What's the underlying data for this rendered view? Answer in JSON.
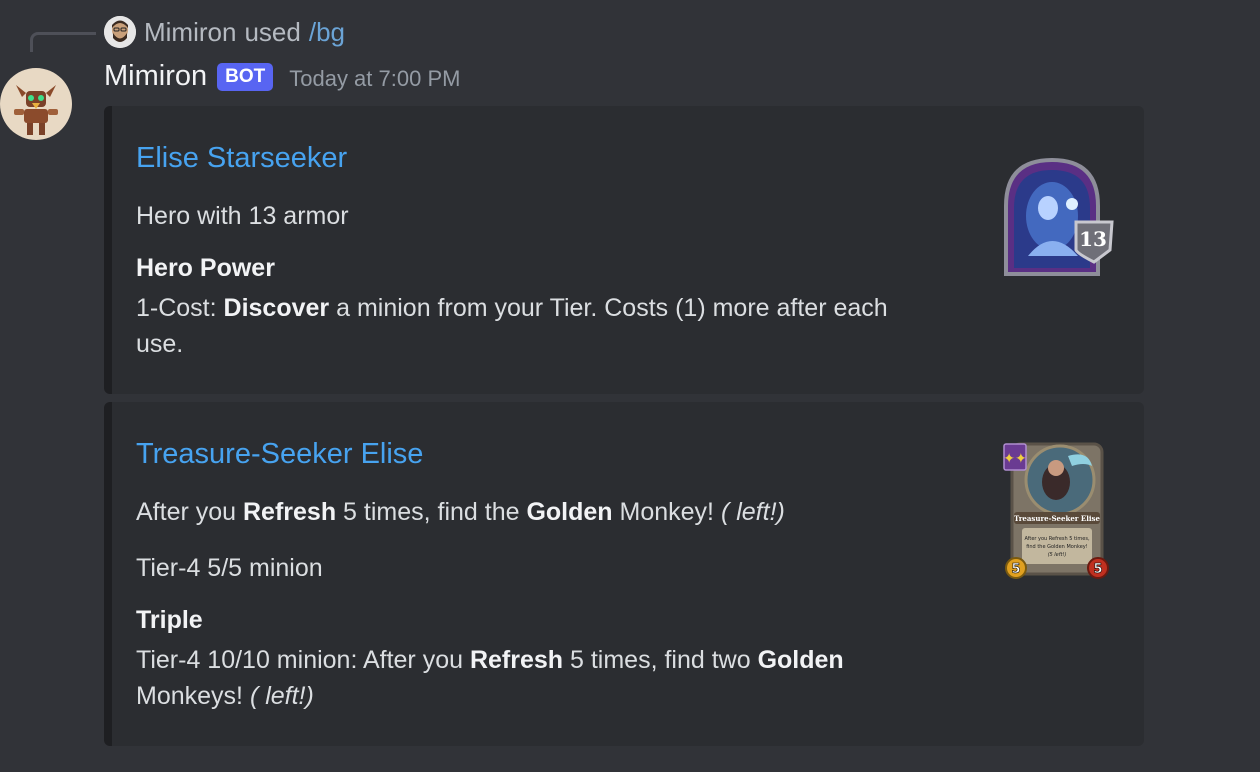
{
  "reply": {
    "user": "Mimiron",
    "used_text": "used",
    "command": "/bg"
  },
  "message": {
    "author": "Mimiron",
    "tag": "BOT",
    "timestamp": "Today at 7:00 PM"
  },
  "embeds": [
    {
      "title": "Elise Starseeker",
      "subtitle": "Hero with 13 armor",
      "field_name": "Hero Power",
      "field_prefix": "1-Cost: ",
      "field_bold": "Discover",
      "field_rest": " a minion from your Tier. Costs (1) more after each use.",
      "armor_value": "13"
    },
    {
      "title": "Treasure-Seeker Elise",
      "desc_prefix": "After you ",
      "desc_bold1": "Refresh",
      "desc_mid": " 5 times, find the ",
      "desc_bold2": "Golden",
      "desc_end": " Monkey! ",
      "desc_italic": "( left!)",
      "stats": "Tier-4 5/5 minion",
      "field_name": "Triple",
      "triple_prefix": "Tier-4 10/10 minion: After you ",
      "triple_bold1": "Refresh",
      "triple_mid": " 5 times, find two ",
      "triple_bold2": "Golden",
      "triple_end": " Monkeys! ",
      "triple_italic": "( left!)",
      "card_name": "Treasure-Seeker Elise",
      "card_attack": "5",
      "card_health": "5"
    }
  ],
  "colors": {
    "background": "#313338",
    "embed_bg": "#2b2d31",
    "link": "#47a3f0",
    "bot_tag": "#5865f2"
  }
}
